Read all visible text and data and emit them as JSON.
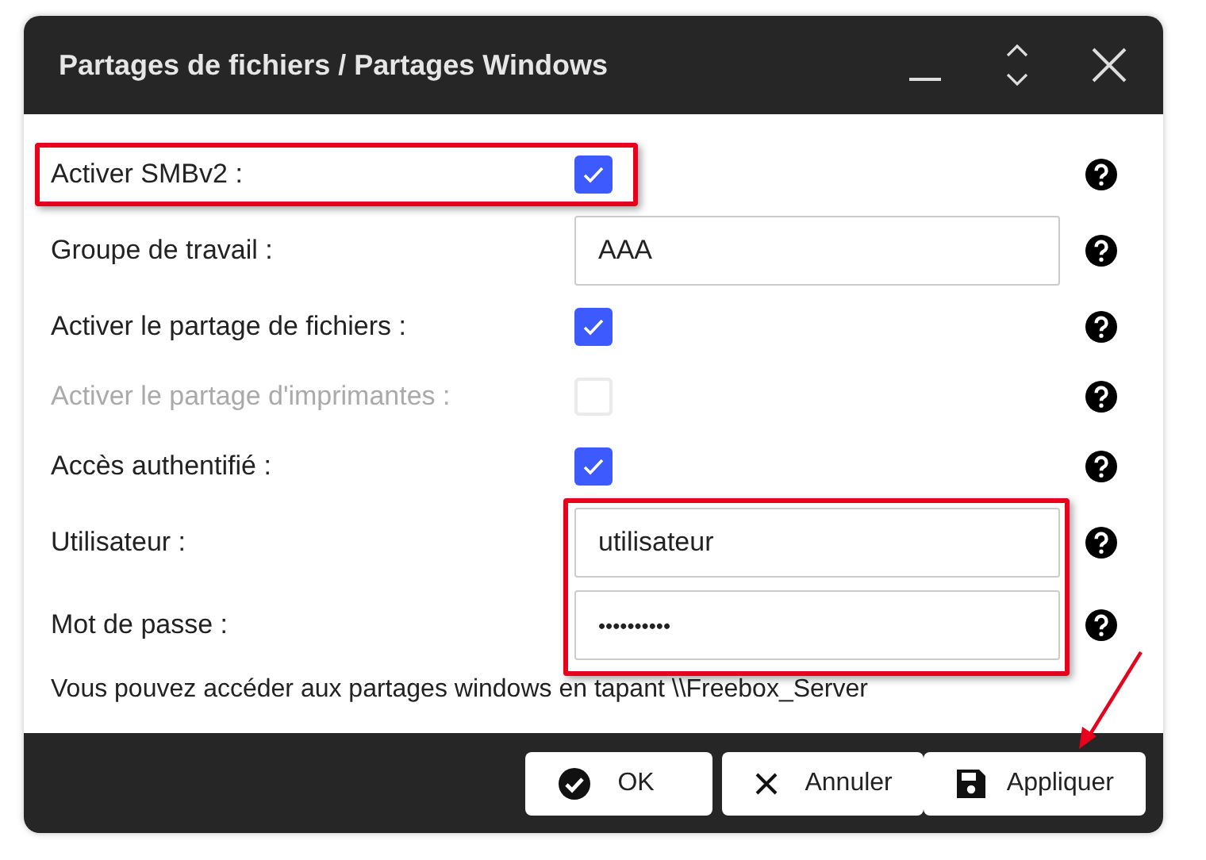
{
  "window": {
    "title": "Partages de fichiers / Partages Windows"
  },
  "rows": [
    {
      "kind": "checkbox",
      "label": "Activer SMBv2 :",
      "checked": true,
      "disabled": false,
      "highlighted": true
    },
    {
      "kind": "text",
      "label": "Groupe de travail :",
      "value": "AAA",
      "highlighted": false
    },
    {
      "kind": "checkbox",
      "label": "Activer le partage de fichiers :",
      "checked": true,
      "disabled": false,
      "highlighted": false
    },
    {
      "kind": "checkbox",
      "label": "Activer le partage d'imprimantes :",
      "checked": false,
      "disabled": true,
      "highlighted": false
    },
    {
      "kind": "checkbox",
      "label": "Accès authentifié :",
      "checked": true,
      "disabled": false,
      "highlighted": false
    },
    {
      "kind": "text",
      "label": "Utilisateur :",
      "value": "utilisateur",
      "highlighted": true
    },
    {
      "kind": "password",
      "label": "Mot de passe :",
      "value": "••••••••••",
      "highlighted": true
    }
  ],
  "note": "Vous pouvez accéder aux partages windows en tapant \\\\Freebox_Server",
  "buttons": [
    {
      "kind": "ok",
      "label": "OK"
    },
    {
      "kind": "cancel",
      "label": "Annuler"
    },
    {
      "kind": "apply",
      "label": "Appliquer"
    }
  ],
  "pointer_arrow": true
}
